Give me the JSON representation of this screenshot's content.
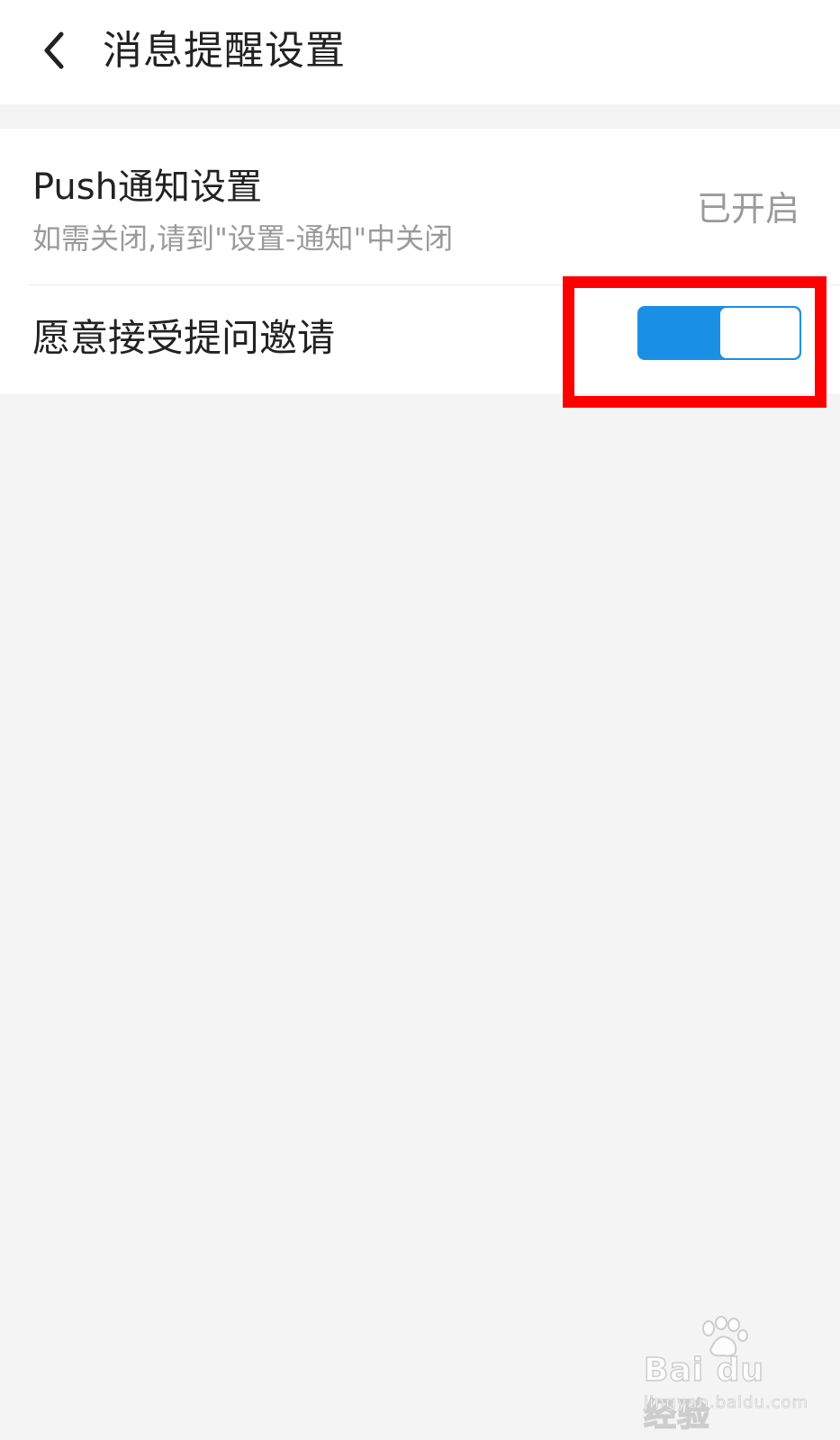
{
  "header": {
    "title": "消息提醒设置",
    "back_icon": "chevron-left-icon"
  },
  "settings": {
    "push": {
      "title": "Push通知设置",
      "subtitle": "如需关闭,请到\"设置-通知\"中关闭",
      "status": "已开启"
    },
    "invite": {
      "label": "愿意接受提问邀请",
      "toggle_on": true
    }
  },
  "colors": {
    "accent": "#1a8fe6",
    "highlight": "#ff0000",
    "background": "#f4f4f4"
  },
  "watermark": {
    "logo": "Bai du 经验",
    "url": "jingyan.baidu.com"
  }
}
